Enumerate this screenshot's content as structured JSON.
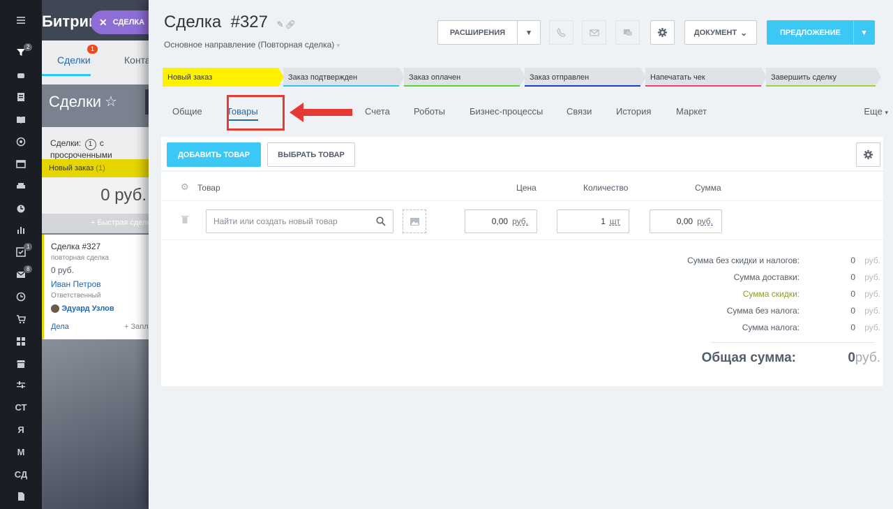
{
  "background": {
    "app_title": "Битрикс",
    "chip_label": "СДЕЛКА",
    "tab_deals": "Сделки",
    "tab_deals_badge": "1",
    "tab_contacts": "Контакты",
    "page_title": "Сделки",
    "filter_text_prefix": "Сделки:",
    "filter_count": "1",
    "filter_text_suffix": "с просроченными",
    "stage_label": "Новый заказ",
    "stage_count": "(1)",
    "stage_sum": "0 руб.",
    "quick_deal": "+ Быстрая сделка",
    "card": {
      "title": "Сделка #327",
      "subtitle": "повторная сделка",
      "amount": "0 руб.",
      "client": "Иван Петров",
      "responsible_label": "Ответственный",
      "responsible_name": "Эдуард Узлов",
      "tasks": "Дела",
      "schedule": "+ Запланировать"
    }
  },
  "rail": {
    "items": [
      {
        "icon": "funnel-icon",
        "badge": "2"
      },
      {
        "icon": "android-icon"
      },
      {
        "icon": "document-icon"
      },
      {
        "icon": "book-icon"
      },
      {
        "icon": "target-icon"
      },
      {
        "icon": "window-icon"
      },
      {
        "icon": "printer-icon"
      },
      {
        "icon": "clock-icon"
      },
      {
        "icon": "chart-icon"
      },
      {
        "icon": "checkbox-icon",
        "badge": "1"
      },
      {
        "icon": "mail-icon",
        "badge": "8"
      },
      {
        "icon": "clock-icon"
      },
      {
        "icon": "cart-icon"
      },
      {
        "icon": "grid-icon"
      },
      {
        "icon": "store-icon"
      },
      {
        "icon": "sliders-icon"
      },
      {
        "text": "СТ"
      },
      {
        "text": "Я"
      },
      {
        "text": "М"
      },
      {
        "text": "СД"
      },
      {
        "icon": "file-icon"
      }
    ]
  },
  "deal": {
    "title": "Сделка",
    "number": "#327",
    "direction": "Основное направление (Повторная сделка)"
  },
  "toolbar": {
    "extensions": "РАСШИРЕНИЯ",
    "document": "ДОКУМЕНТ",
    "proposal": "ПРЕДЛОЖЕНИЕ"
  },
  "stages": [
    {
      "label": "Новый заказ",
      "color": "#fff200",
      "fill": "#fff200"
    },
    {
      "label": "Заказ подтвержден",
      "color": "#2fc6f6",
      "fill": "#dfe3e7"
    },
    {
      "label": "Заказ оплачен",
      "color": "#55d62a",
      "fill": "#dfe3e7"
    },
    {
      "label": "Заказ отправлен",
      "color": "#1f3fbf",
      "fill": "#dfe3e7"
    },
    {
      "label": "Напечатать чек",
      "color": "#f2416b",
      "fill": "#dfe3e7"
    },
    {
      "label": "Завершить сделку",
      "color": "#9fd13b",
      "fill": "#dfe3e7"
    }
  ],
  "tabs": [
    "Общие",
    "Товары",
    "Счета",
    "Роботы",
    "Бизнес-процессы",
    "Связи",
    "История",
    "Маркет"
  ],
  "tabs_more": "Еще",
  "products": {
    "add_button": "ДОБАВИТЬ ТОВАР",
    "select_button": "ВЫБРАТЬ ТОВАР",
    "col_product": "Товар",
    "col_price": "Цена",
    "col_qty": "Количество",
    "col_sum": "Сумма",
    "search_placeholder": "Найти или создать новый товар",
    "price_value": "0,00",
    "price_unit": "руб.",
    "qty_value": "1",
    "qty_unit": "шт",
    "sum_value": "0,00",
    "sum_unit": "руб."
  },
  "totals": {
    "rows": [
      {
        "label": "Сумма без скидки и налогов:",
        "value": "0",
        "currency": "руб."
      },
      {
        "label": "Сумма доставки:",
        "value": "0",
        "currency": "руб."
      },
      {
        "label": "Сумма скидки:",
        "value": "0",
        "currency": "руб."
      },
      {
        "label": "Сумма без налога:",
        "value": "0",
        "currency": "руб."
      },
      {
        "label": "Сумма налога:",
        "value": "0",
        "currency": "руб."
      }
    ],
    "grand_label": "Общая сумма:",
    "grand_value": "0",
    "grand_currency": "руб."
  }
}
